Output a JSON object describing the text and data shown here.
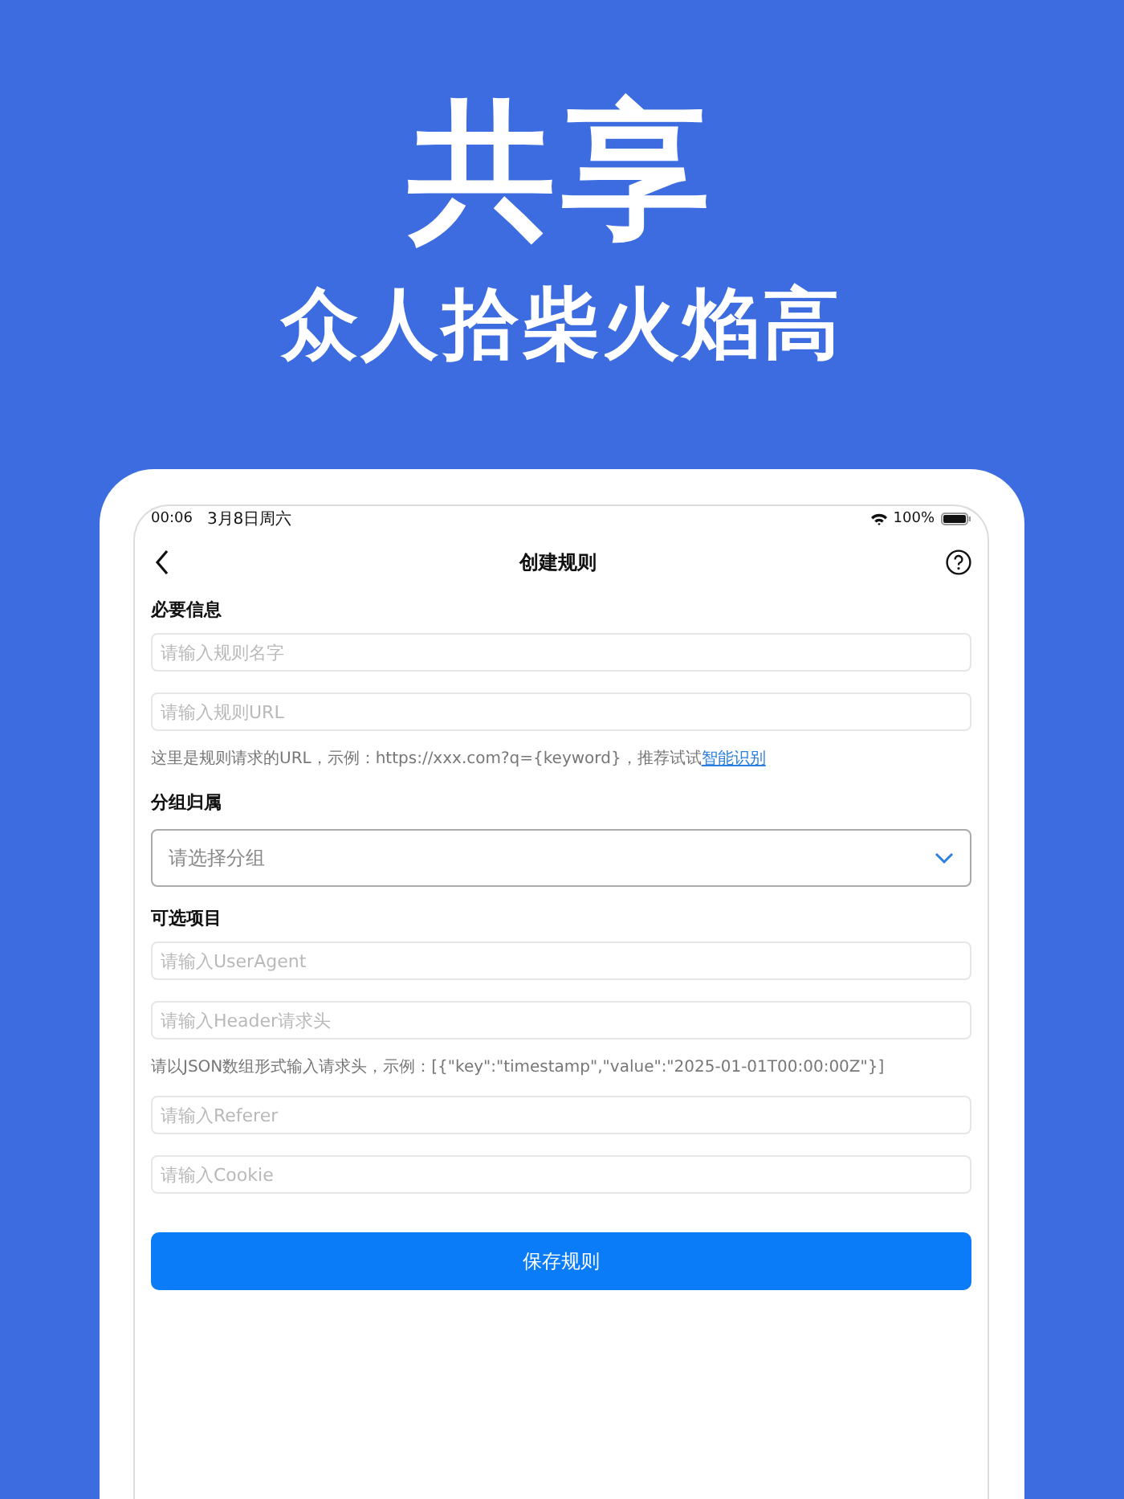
{
  "hero": {
    "title": "共享",
    "subtitle": "众人拾柴火焰高"
  },
  "status_bar": {
    "time": "00:06",
    "date": "3月8日周六",
    "battery": "100%"
  },
  "nav": {
    "title": "创建规则"
  },
  "sections": [
    {
      "title": "必要信息",
      "items": [
        {
          "kind": "field",
          "placeholder": "请输入规则名字"
        },
        {
          "kind": "field",
          "placeholder": "请输入规则URL"
        },
        {
          "kind": "hint",
          "text": "这里是规则请求的URL，示例：https://xxx.com?q={keyword}，推荐试试",
          "link": "智能识别"
        }
      ]
    },
    {
      "title": "分组归属",
      "items": [
        {
          "kind": "select",
          "placeholder": "请选择分组"
        }
      ]
    },
    {
      "title": "可选项目",
      "items": [
        {
          "kind": "field",
          "placeholder": "请输入UserAgent"
        },
        {
          "kind": "field",
          "placeholder": "请输入Header请求头"
        },
        {
          "kind": "hint",
          "text": "请以JSON数组形式输入请求头，示例：[{\"key\":\"timestamp\",\"value\":\"2025-01-01T00:00:00Z\"}]"
        },
        {
          "kind": "field",
          "placeholder": "请输入Referer"
        },
        {
          "kind": "field",
          "placeholder": "请输入Cookie"
        }
      ]
    }
  ],
  "save_button": "保存规则"
}
